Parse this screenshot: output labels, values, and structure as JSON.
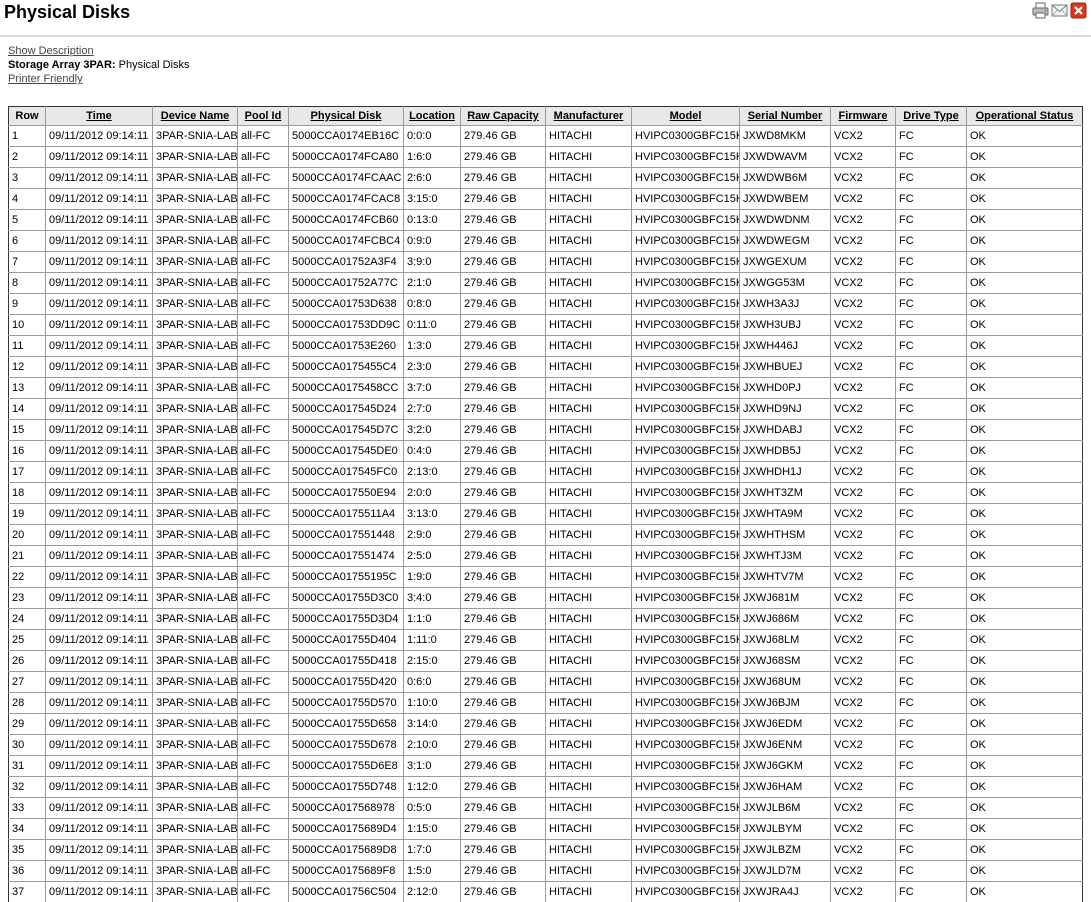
{
  "header": {
    "title": "Physical Disks",
    "icons": [
      "printer-icon",
      "email-icon",
      "close-icon"
    ],
    "close_color": "#d9381e"
  },
  "links": {
    "show_description": "Show Description",
    "storage_label": "Storage Array 3PAR:",
    "storage_value": "Physical Disks",
    "printer_friendly": "Printer Friendly"
  },
  "table": {
    "columns": [
      "Row",
      "Time",
      "Device Name",
      "Pool Id",
      "Physical Disk",
      "Location",
      "Raw Capacity",
      "Manufacturer",
      "Model",
      "Serial Number",
      "Firmware",
      "Drive Type",
      "Operational Status"
    ],
    "rows": [
      [
        "1",
        "09/11/2012 09:14:11",
        "3PAR-SNIA-LAB",
        "all-FC",
        "5000CCA0174EB16C",
        "0:0:0",
        "279.46 GB",
        "HITACHI",
        "HVIPC0300GBFC15K",
        "JXWD8MKM",
        "VCX2",
        "FC",
        "OK"
      ],
      [
        "2",
        "09/11/2012 09:14:11",
        "3PAR-SNIA-LAB",
        "all-FC",
        "5000CCA0174FCA80",
        "1:6:0",
        "279.46 GB",
        "HITACHI",
        "HVIPC0300GBFC15K",
        "JXWDWAVM",
        "VCX2",
        "FC",
        "OK"
      ],
      [
        "3",
        "09/11/2012 09:14:11",
        "3PAR-SNIA-LAB",
        "all-FC",
        "5000CCA0174FCAAC",
        "2:6:0",
        "279.46 GB",
        "HITACHI",
        "HVIPC0300GBFC15K",
        "JXWDWB6M",
        "VCX2",
        "FC",
        "OK"
      ],
      [
        "4",
        "09/11/2012 09:14:11",
        "3PAR-SNIA-LAB",
        "all-FC",
        "5000CCA0174FCAC8",
        "3:15:0",
        "279.46 GB",
        "HITACHI",
        "HVIPC0300GBFC15K",
        "JXWDWBEM",
        "VCX2",
        "FC",
        "OK"
      ],
      [
        "5",
        "09/11/2012 09:14:11",
        "3PAR-SNIA-LAB",
        "all-FC",
        "5000CCA0174FCB60",
        "0:13:0",
        "279.46 GB",
        "HITACHI",
        "HVIPC0300GBFC15K",
        "JXWDWDNM",
        "VCX2",
        "FC",
        "OK"
      ],
      [
        "6",
        "09/11/2012 09:14:11",
        "3PAR-SNIA-LAB",
        "all-FC",
        "5000CCA0174FCBC4",
        "0:9:0",
        "279.46 GB",
        "HITACHI",
        "HVIPC0300GBFC15K",
        "JXWDWEGM",
        "VCX2",
        "FC",
        "OK"
      ],
      [
        "7",
        "09/11/2012 09:14:11",
        "3PAR-SNIA-LAB",
        "all-FC",
        "5000CCA01752A3F4",
        "3:9:0",
        "279.46 GB",
        "HITACHI",
        "HVIPC0300GBFC15K",
        "JXWGEXUM",
        "VCX2",
        "FC",
        "OK"
      ],
      [
        "8",
        "09/11/2012 09:14:11",
        "3PAR-SNIA-LAB",
        "all-FC",
        "5000CCA01752A77C",
        "2:1:0",
        "279.46 GB",
        "HITACHI",
        "HVIPC0300GBFC15K",
        "JXWGG53M",
        "VCX2",
        "FC",
        "OK"
      ],
      [
        "9",
        "09/11/2012 09:14:11",
        "3PAR-SNIA-LAB",
        "all-FC",
        "5000CCA01753D638",
        "0:8:0",
        "279.46 GB",
        "HITACHI",
        "HVIPC0300GBFC15K",
        "JXWH3A3J",
        "VCX2",
        "FC",
        "OK"
      ],
      [
        "10",
        "09/11/2012 09:14:11",
        "3PAR-SNIA-LAB",
        "all-FC",
        "5000CCA01753DD9C",
        "0:11:0",
        "279.46 GB",
        "HITACHI",
        "HVIPC0300GBFC15K",
        "JXWH3UBJ",
        "VCX2",
        "FC",
        "OK"
      ],
      [
        "11",
        "09/11/2012 09:14:11",
        "3PAR-SNIA-LAB",
        "all-FC",
        "5000CCA01753E260",
        "1:3:0",
        "279.46 GB",
        "HITACHI",
        "HVIPC0300GBFC15K",
        "JXWH446J",
        "VCX2",
        "FC",
        "OK"
      ],
      [
        "12",
        "09/11/2012 09:14:11",
        "3PAR-SNIA-LAB",
        "all-FC",
        "5000CCA0175455C4",
        "2:3:0",
        "279.46 GB",
        "HITACHI",
        "HVIPC0300GBFC15K",
        "JXWHBUEJ",
        "VCX2",
        "FC",
        "OK"
      ],
      [
        "13",
        "09/11/2012 09:14:11",
        "3PAR-SNIA-LAB",
        "all-FC",
        "5000CCA0175458CC",
        "3:7:0",
        "279.46 GB",
        "HITACHI",
        "HVIPC0300GBFC15K",
        "JXWHD0PJ",
        "VCX2",
        "FC",
        "OK"
      ],
      [
        "14",
        "09/11/2012 09:14:11",
        "3PAR-SNIA-LAB",
        "all-FC",
        "5000CCA017545D24",
        "2:7:0",
        "279.46 GB",
        "HITACHI",
        "HVIPC0300GBFC15K",
        "JXWHD9NJ",
        "VCX2",
        "FC",
        "OK"
      ],
      [
        "15",
        "09/11/2012 09:14:11",
        "3PAR-SNIA-LAB",
        "all-FC",
        "5000CCA017545D7C",
        "3:2:0",
        "279.46 GB",
        "HITACHI",
        "HVIPC0300GBFC15K",
        "JXWHDABJ",
        "VCX2",
        "FC",
        "OK"
      ],
      [
        "16",
        "09/11/2012 09:14:11",
        "3PAR-SNIA-LAB",
        "all-FC",
        "5000CCA017545DE0",
        "0:4:0",
        "279.46 GB",
        "HITACHI",
        "HVIPC0300GBFC15K",
        "JXWHDB5J",
        "VCX2",
        "FC",
        "OK"
      ],
      [
        "17",
        "09/11/2012 09:14:11",
        "3PAR-SNIA-LAB",
        "all-FC",
        "5000CCA017545FC0",
        "2:13:0",
        "279.46 GB",
        "HITACHI",
        "HVIPC0300GBFC15K",
        "JXWHDH1J",
        "VCX2",
        "FC",
        "OK"
      ],
      [
        "18",
        "09/11/2012 09:14:11",
        "3PAR-SNIA-LAB",
        "all-FC",
        "5000CCA017550E94",
        "2:0:0",
        "279.46 GB",
        "HITACHI",
        "HVIPC0300GBFC15K",
        "JXWHT3ZM",
        "VCX2",
        "FC",
        "OK"
      ],
      [
        "19",
        "09/11/2012 09:14:11",
        "3PAR-SNIA-LAB",
        "all-FC",
        "5000CCA0175511A4",
        "3:13:0",
        "279.46 GB",
        "HITACHI",
        "HVIPC0300GBFC15K",
        "JXWHTA9M",
        "VCX2",
        "FC",
        "OK"
      ],
      [
        "20",
        "09/11/2012 09:14:11",
        "3PAR-SNIA-LAB",
        "all-FC",
        "5000CCA017551448",
        "2:9:0",
        "279.46 GB",
        "HITACHI",
        "HVIPC0300GBFC15K",
        "JXWHTHSM",
        "VCX2",
        "FC",
        "OK"
      ],
      [
        "21",
        "09/11/2012 09:14:11",
        "3PAR-SNIA-LAB",
        "all-FC",
        "5000CCA017551474",
        "2:5:0",
        "279.46 GB",
        "HITACHI",
        "HVIPC0300GBFC15K",
        "JXWHTJ3M",
        "VCX2",
        "FC",
        "OK"
      ],
      [
        "22",
        "09/11/2012 09:14:11",
        "3PAR-SNIA-LAB",
        "all-FC",
        "5000CCA01755195C",
        "1:9:0",
        "279.46 GB",
        "HITACHI",
        "HVIPC0300GBFC15K",
        "JXWHTV7M",
        "VCX2",
        "FC",
        "OK"
      ],
      [
        "23",
        "09/11/2012 09:14:11",
        "3PAR-SNIA-LAB",
        "all-FC",
        "5000CCA01755D3C0",
        "3:4:0",
        "279.46 GB",
        "HITACHI",
        "HVIPC0300GBFC15K",
        "JXWJ681M",
        "VCX2",
        "FC",
        "OK"
      ],
      [
        "24",
        "09/11/2012 09:14:11",
        "3PAR-SNIA-LAB",
        "all-FC",
        "5000CCA01755D3D4",
        "1:1:0",
        "279.46 GB",
        "HITACHI",
        "HVIPC0300GBFC15K",
        "JXWJ686M",
        "VCX2",
        "FC",
        "OK"
      ],
      [
        "25",
        "09/11/2012 09:14:11",
        "3PAR-SNIA-LAB",
        "all-FC",
        "5000CCA01755D404",
        "1:11:0",
        "279.46 GB",
        "HITACHI",
        "HVIPC0300GBFC15K",
        "JXWJ68LM",
        "VCX2",
        "FC",
        "OK"
      ],
      [
        "26",
        "09/11/2012 09:14:11",
        "3PAR-SNIA-LAB",
        "all-FC",
        "5000CCA01755D418",
        "2:15:0",
        "279.46 GB",
        "HITACHI",
        "HVIPC0300GBFC15K",
        "JXWJ68SM",
        "VCX2",
        "FC",
        "OK"
      ],
      [
        "27",
        "09/11/2012 09:14:11",
        "3PAR-SNIA-LAB",
        "all-FC",
        "5000CCA01755D420",
        "0:6:0",
        "279.46 GB",
        "HITACHI",
        "HVIPC0300GBFC15K",
        "JXWJ68UM",
        "VCX2",
        "FC",
        "OK"
      ],
      [
        "28",
        "09/11/2012 09:14:11",
        "3PAR-SNIA-LAB",
        "all-FC",
        "5000CCA01755D570",
        "1:10:0",
        "279.46 GB",
        "HITACHI",
        "HVIPC0300GBFC15K",
        "JXWJ6BJM",
        "VCX2",
        "FC",
        "OK"
      ],
      [
        "29",
        "09/11/2012 09:14:11",
        "3PAR-SNIA-LAB",
        "all-FC",
        "5000CCA01755D658",
        "3:14:0",
        "279.46 GB",
        "HITACHI",
        "HVIPC0300GBFC15K",
        "JXWJ6EDM",
        "VCX2",
        "FC",
        "OK"
      ],
      [
        "30",
        "09/11/2012 09:14:11",
        "3PAR-SNIA-LAB",
        "all-FC",
        "5000CCA01755D678",
        "2:10:0",
        "279.46 GB",
        "HITACHI",
        "HVIPC0300GBFC15K",
        "JXWJ6ENM",
        "VCX2",
        "FC",
        "OK"
      ],
      [
        "31",
        "09/11/2012 09:14:11",
        "3PAR-SNIA-LAB",
        "all-FC",
        "5000CCA01755D6E8",
        "3:1:0",
        "279.46 GB",
        "HITACHI",
        "HVIPC0300GBFC15K",
        "JXWJ6GKM",
        "VCX2",
        "FC",
        "OK"
      ],
      [
        "32",
        "09/11/2012 09:14:11",
        "3PAR-SNIA-LAB",
        "all-FC",
        "5000CCA01755D748",
        "1:12:0",
        "279.46 GB",
        "HITACHI",
        "HVIPC0300GBFC15K",
        "JXWJ6HAM",
        "VCX2",
        "FC",
        "OK"
      ],
      [
        "33",
        "09/11/2012 09:14:11",
        "3PAR-SNIA-LAB",
        "all-FC",
        "5000CCA017568978",
        "0:5:0",
        "279.46 GB",
        "HITACHI",
        "HVIPC0300GBFC15K",
        "JXWJLB6M",
        "VCX2",
        "FC",
        "OK"
      ],
      [
        "34",
        "09/11/2012 09:14:11",
        "3PAR-SNIA-LAB",
        "all-FC",
        "5000CCA0175689D4",
        "1:15:0",
        "279.46 GB",
        "HITACHI",
        "HVIPC0300GBFC15K",
        "JXWJLBYM",
        "VCX2",
        "FC",
        "OK"
      ],
      [
        "35",
        "09/11/2012 09:14:11",
        "3PAR-SNIA-LAB",
        "all-FC",
        "5000CCA0175689D8",
        "1:7:0",
        "279.46 GB",
        "HITACHI",
        "HVIPC0300GBFC15K",
        "JXWJLBZM",
        "VCX2",
        "FC",
        "OK"
      ],
      [
        "36",
        "09/11/2012 09:14:11",
        "3PAR-SNIA-LAB",
        "all-FC",
        "5000CCA0175689F8",
        "1:5:0",
        "279.46 GB",
        "HITACHI",
        "HVIPC0300GBFC15K",
        "JXWJLD7M",
        "VCX2",
        "FC",
        "OK"
      ],
      [
        "37",
        "09/11/2012 09:14:11",
        "3PAR-SNIA-LAB",
        "all-FC",
        "5000CCA01756C504",
        "2:12:0",
        "279.46 GB",
        "HITACHI",
        "HVIPC0300GBFC15K",
        "JXWJRA4J",
        "VCX2",
        "FC",
        "OK"
      ]
    ]
  }
}
